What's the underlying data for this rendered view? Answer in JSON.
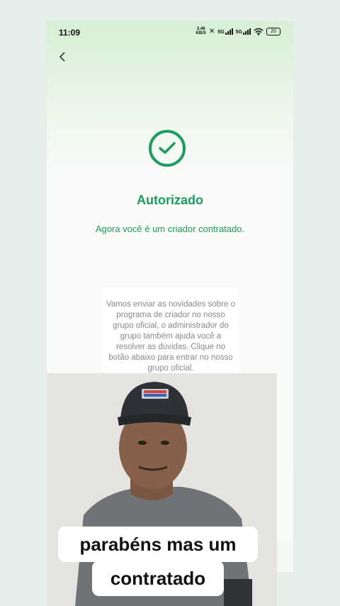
{
  "status_bar": {
    "time": "11:09",
    "network_speed_value": "3.46",
    "network_speed_unit": "KB/S",
    "signal_1": "5G",
    "signal_2": "5G",
    "battery": "20"
  },
  "screen": {
    "title": "Autorizado",
    "subtitle": "Agora você é um criador contratado.",
    "info_text": "Vamos enviar as novidades sobre o programa de criador no nosso grupo oficial, o administrador do grupo também ajuda você a resolver as dúvidas. Clique no botão abaixo para entrar no nosso grupo oficial.",
    "accent_color": "#1f9a60"
  },
  "video_overlay": {
    "caption_line_1": "parabéns mas um",
    "caption_line_2": "contratado"
  }
}
